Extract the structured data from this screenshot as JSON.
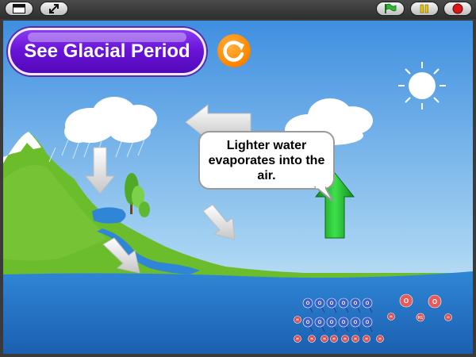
{
  "toolbar": {
    "left_buttons": [
      "presentation-mode",
      "fullscreen"
    ],
    "right_buttons": [
      "green-flag",
      "pause",
      "stop"
    ]
  },
  "scene": {
    "button_label": "See Glacial Period",
    "caption": "Lighter water evaporates into the air.",
    "molecule_labels": {
      "o": "O",
      "h": "H",
      "h1": "H1"
    },
    "colors": {
      "sky": "#8ec3ea",
      "ocean": "#2a78c8",
      "land": "#6cbd2c",
      "button_purple": "#6a14d8",
      "reset_orange": "#ff8a00",
      "arrow_green": "#22c032",
      "molecule_blue": "#3a5fc8",
      "molecule_red": "#e85a5a"
    }
  }
}
